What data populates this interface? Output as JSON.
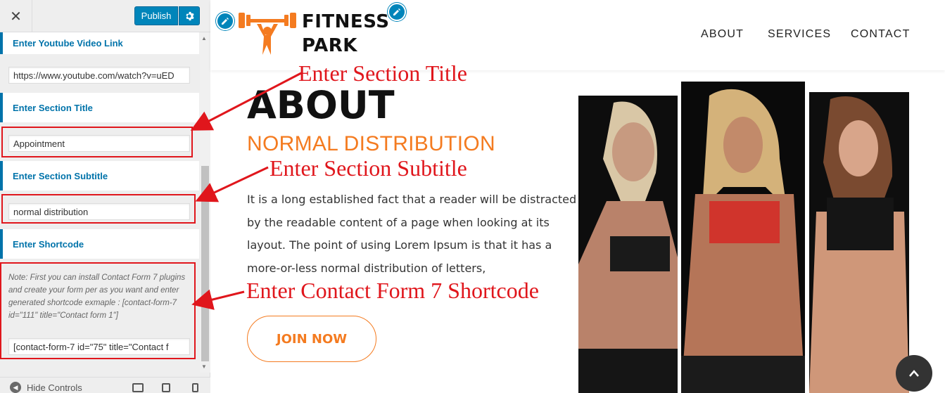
{
  "customizer": {
    "close_icon": "close-icon",
    "publish_label": "Publish",
    "settings_icon": "gear-icon",
    "sections": [
      {
        "label": "Enter Youtube Video Link",
        "value": "https://www.youtube.com/watch?v=uED"
      },
      {
        "label": "Enter Section Title",
        "value": "Appointment"
      },
      {
        "label": "Enter Section Subtitle",
        "value": "normal distribution"
      },
      {
        "label": "Enter Shortcode",
        "value": "[contact-form-7 id=\"75\" title=\"Contact f"
      }
    ],
    "shortcode_note": "Note: First you can install Contact Form 7 plugins and create your form per as you want and enter generated shortcode exmaple : [contact-form-7 id=\"111\" title=\"Contact form 1\"]",
    "footer": {
      "hide_controls": "Hide Controls",
      "devices": [
        "desktop-icon",
        "tablet-icon",
        "mobile-icon"
      ]
    }
  },
  "site": {
    "logo_line1": "FITNESS",
    "logo_line2": "PARK",
    "nav": [
      "ABOUT",
      "SERVICES",
      "CONTACT"
    ],
    "about_title": "ABOUT",
    "about_subtitle": "NORMAL DISTRIBUTION",
    "about_body": "It is a long established fact that a reader will be distracted by the readable content of a page when looking at its layout. The point of using Lorem Ipsum is that it has a more-or-less normal distribution of letters,",
    "join_button": "JOIN NOW"
  },
  "annotations": [
    "Enter Section Title",
    "Enter Section Subtitle",
    "Enter Contact Form 7 Shortcode"
  ],
  "colors": {
    "accent_blue": "#0073aa",
    "publish_blue": "#0085ba",
    "brand_orange": "#f47b20",
    "annotation_red": "#e0161c"
  }
}
